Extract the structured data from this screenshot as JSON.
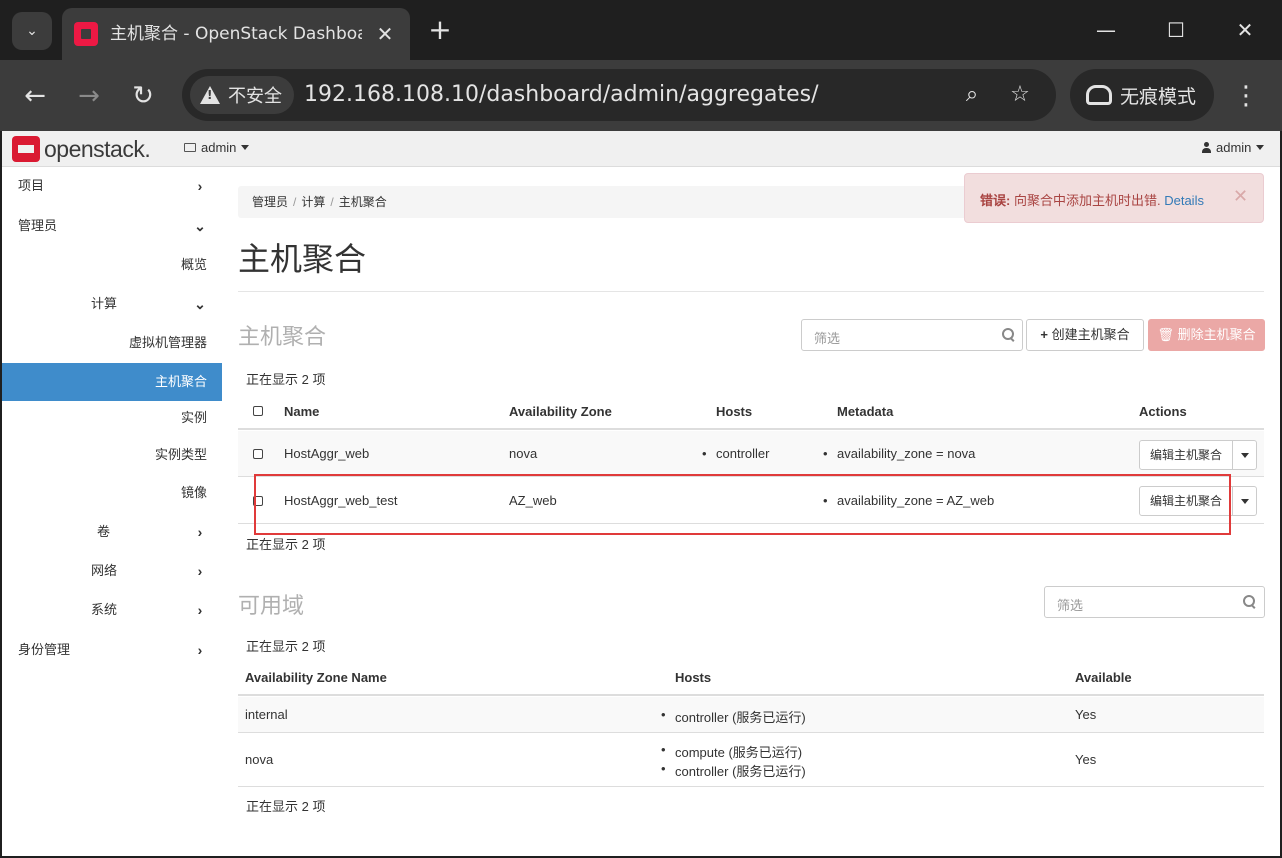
{
  "browser": {
    "tab_title": "主机聚合 - OpenStack Dashboard",
    "security_label": "不安全",
    "url": "192.168.108.10/dashboard/admin/aggregates/",
    "incognito_label": "无痕模式"
  },
  "topnav": {
    "logo_text": "openstack.",
    "project": "admin",
    "user": "admin"
  },
  "sidebar": {
    "items": [
      {
        "label": "项目"
      },
      {
        "label": "管理员"
      },
      {
        "label": "概览"
      },
      {
        "label": "计算"
      },
      {
        "label": "虚拟机管理器"
      },
      {
        "label": "主机聚合"
      },
      {
        "label": "实例"
      },
      {
        "label": "实例类型"
      },
      {
        "label": "镜像"
      },
      {
        "label": "卷"
      },
      {
        "label": "网络"
      },
      {
        "label": "系统"
      },
      {
        "label": "身份管理"
      }
    ]
  },
  "breadcrumb": [
    "管理员",
    "计算",
    "主机聚合"
  ],
  "alert": {
    "prefix": "错误:",
    "message": "向聚合中添加主机时出错.",
    "link": "Details",
    "close": "✕"
  },
  "page_title": "主机聚合",
  "aggregates": {
    "title": "主机聚合",
    "filter_placeholder": "筛选",
    "create_label": "创建主机聚合",
    "delete_label": "删除主机聚合",
    "count_text": "正在显示 2 项",
    "columns": [
      "Name",
      "Availability Zone",
      "Hosts",
      "Metadata",
      "Actions"
    ],
    "rows": [
      {
        "name": "HostAggr_web",
        "zone": "nova",
        "host": "controller",
        "metadata": "availability_zone = nova",
        "action": "编辑主机聚合"
      },
      {
        "name": "HostAggr_web_test",
        "zone": "AZ_web",
        "host": "",
        "metadata": "availability_zone = AZ_web",
        "action": "编辑主机聚合"
      }
    ]
  },
  "zones": {
    "title": "可用域",
    "filter_placeholder": "筛选",
    "count_text": "正在显示 2 项",
    "columns": [
      "Availability Zone Name",
      "Hosts",
      "Available"
    ],
    "rows": [
      {
        "name": "internal",
        "hosts": [
          "controller (服务已运行)"
        ],
        "available": "Yes"
      },
      {
        "name": "nova",
        "hosts": [
          "compute (服务已运行)",
          "controller (服务已运行)"
        ],
        "available": "Yes"
      }
    ]
  },
  "colors": {
    "sidebar_active": "#3f8ccb",
    "danger_button": "#eba8a6",
    "alert_bg": "#f2dede",
    "highlight_box": "#e03a3a"
  }
}
